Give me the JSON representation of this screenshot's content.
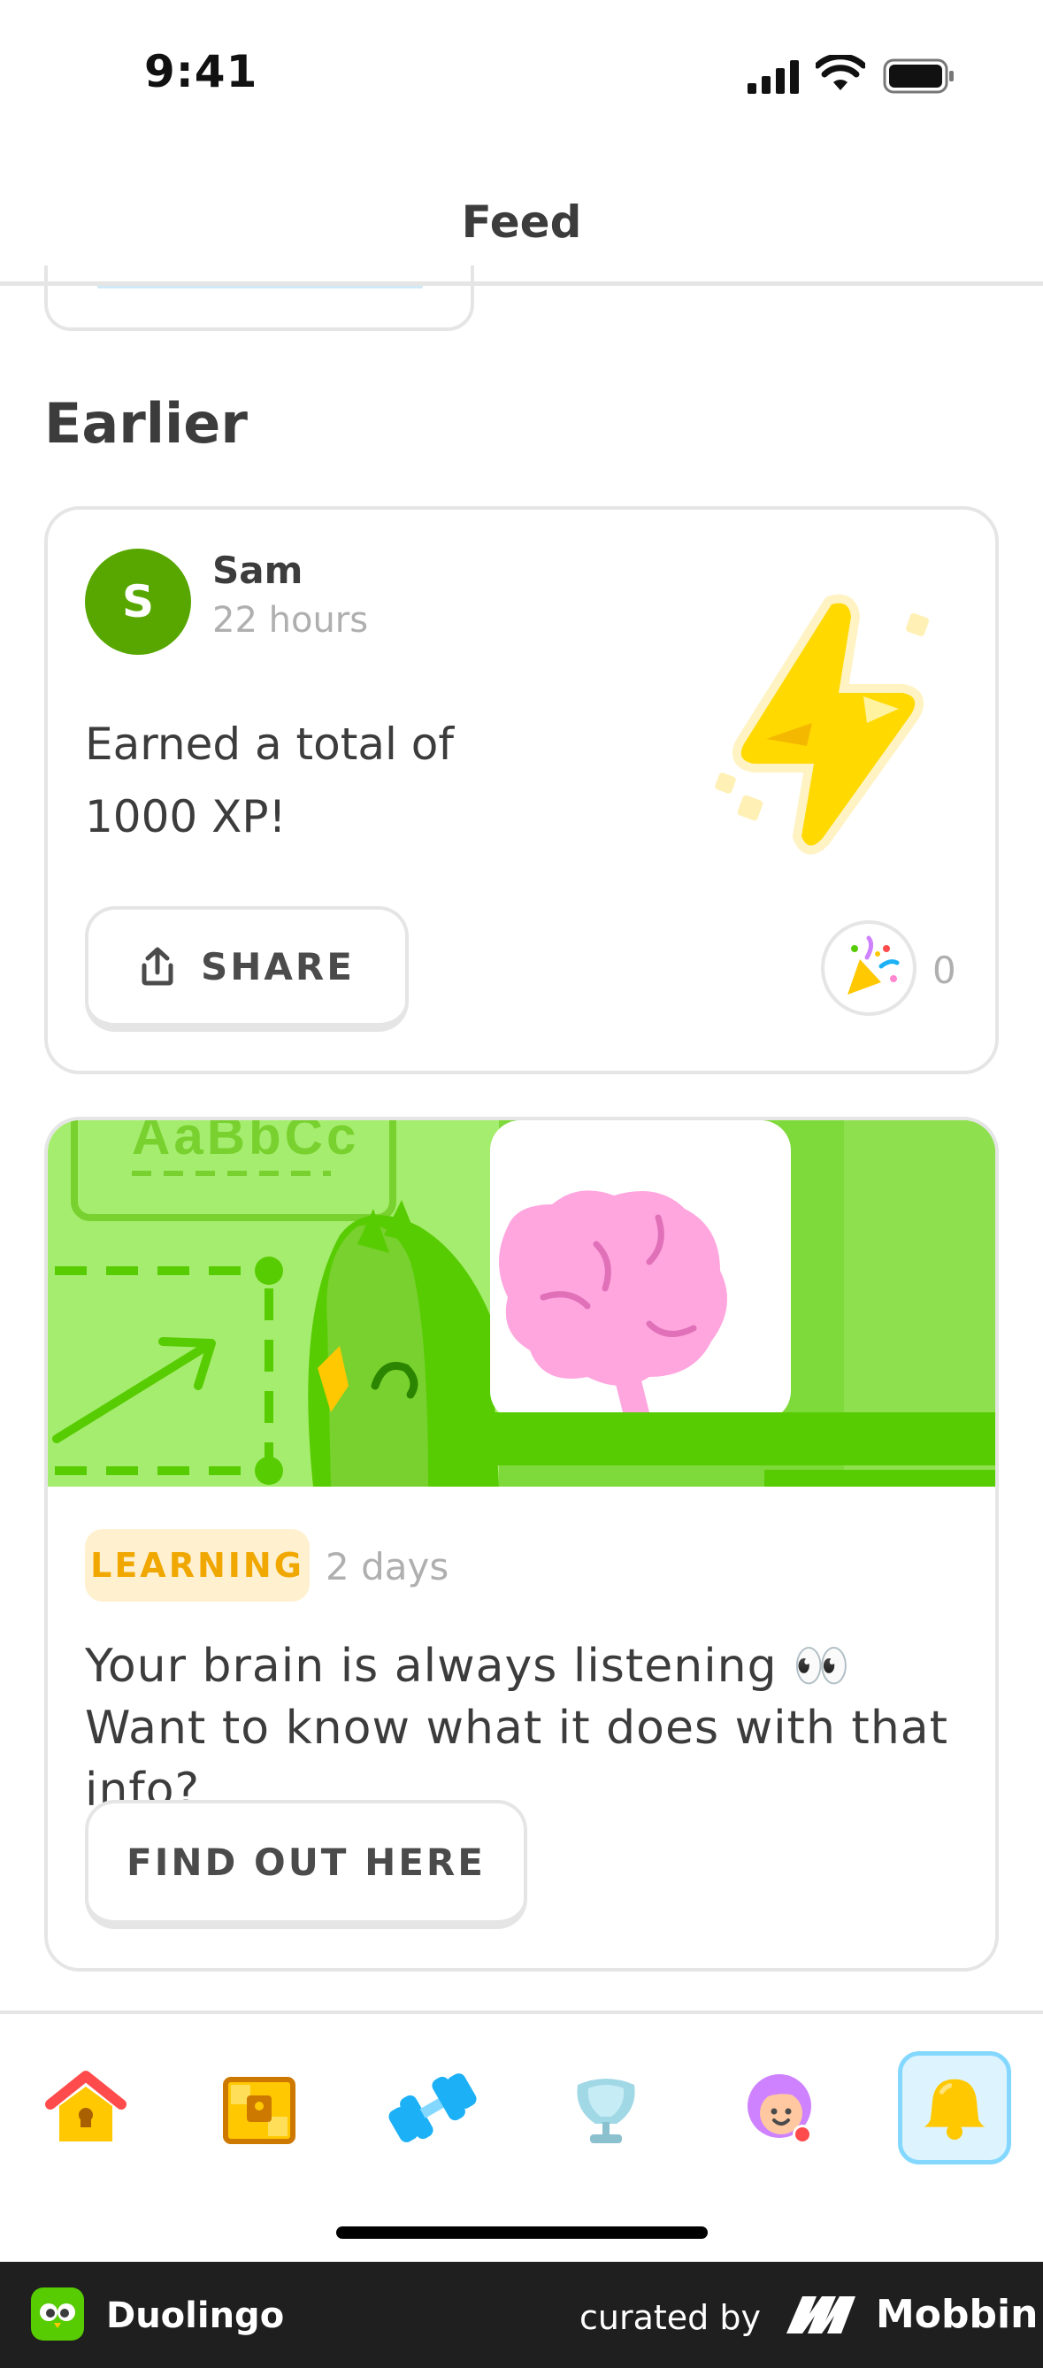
{
  "status_bar": {
    "time": "9:41"
  },
  "header": {
    "title": "Feed"
  },
  "section": {
    "title": "Earlier"
  },
  "activity_card": {
    "avatar_letter": "S",
    "user_name": "Sam",
    "time": "22 hours",
    "text": "Earned a total of 1000 XP!",
    "share_label": "SHARE",
    "celebrate_count": "0"
  },
  "news_card": {
    "banner_text": "AaBbCc",
    "tag": "LEARNING",
    "time": "2 days",
    "text": "Your brain is always listening 👀 Want to know what it does with that info?",
    "button_label": "FIND OUT HERE"
  },
  "bottom_nav": {
    "items": [
      "home-icon",
      "chest-icon",
      "dumbbell-icon",
      "shield-icon",
      "profile-icon",
      "bell-icon"
    ],
    "active": "bell-icon"
  },
  "watermark": {
    "app_name": "Duolingo",
    "curated_by": "curated by",
    "brand": "Mobbin"
  },
  "colors": {
    "accent_green": "#58a700",
    "tag_bg": "#fff1d0",
    "tag_text": "#f0a700",
    "active_nav_border": "#84d8ff"
  }
}
